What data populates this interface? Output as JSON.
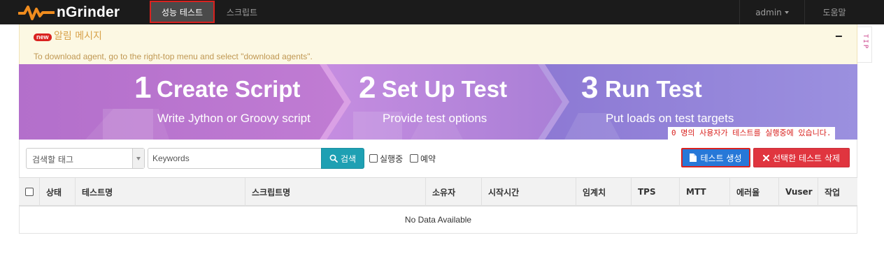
{
  "navbar": {
    "logo_text": "nGrinder",
    "performance_test": "성능 테스트",
    "script": "스크립트",
    "admin": "admin",
    "help": "도움말"
  },
  "alert": {
    "badge": "new",
    "title": "알림 메시지",
    "collapse": "−",
    "message": "To download agent, go to the right-top menu and select \"download agents\"."
  },
  "tip_tab": "TIP",
  "banner": {
    "steps": [
      {
        "number": "1",
        "title": "Create Script",
        "subtitle": "Write Jython or Groovy script"
      },
      {
        "number": "2",
        "title": "Set Up Test",
        "subtitle": "Provide test options"
      },
      {
        "number": "3",
        "title": "Run Test",
        "subtitle": "Put loads on test targets"
      }
    ],
    "running_users": "0 명의 사용자가 테스트를 실행중에 있습니다."
  },
  "filters": {
    "tag_select": "검색할 태그",
    "keyword_placeholder": "Keywords",
    "search_button": "검색",
    "running_label": "실행중",
    "scheduled_label": "예약",
    "create_button": "테스트 생성",
    "delete_button": "선택한 테스트 삭제"
  },
  "table": {
    "columns": [
      "상태",
      "테스트명",
      "스크립트명",
      "소유자",
      "시작시간",
      "임계치",
      "TPS",
      "MTT",
      "에러율",
      "Vuser",
      "작업"
    ],
    "empty_message": "No Data Available"
  },
  "colors": {
    "navbar_bg": "#1b1b1b",
    "logo_orange": "#f08c1e",
    "highlight_red": "#d9221f",
    "alert_bg": "#fcf8e3",
    "search_teal": "#1ea0b3",
    "create_blue": "#2778d8",
    "delete_red": "#e0353f"
  }
}
